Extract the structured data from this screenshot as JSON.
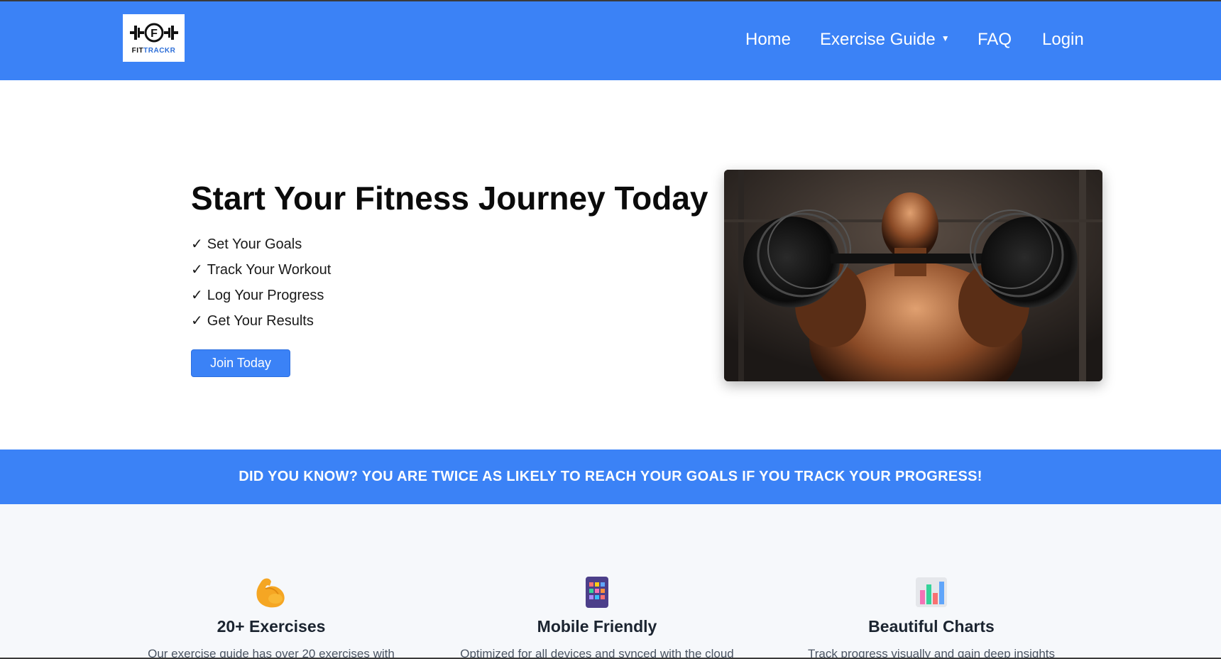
{
  "brand": {
    "logo_text_fit": "FIT",
    "logo_text_trackr": "TRACKR",
    "logo_letter": "F"
  },
  "nav": {
    "home": "Home",
    "exercise_guide": "Exercise Guide",
    "faq": "FAQ",
    "login": "Login"
  },
  "hero": {
    "title": "Start Your Fitness Journey Today",
    "checkmark": "✓",
    "items": [
      "Set Your Goals",
      "Track Your Workout",
      "Log Your Progress",
      "Get Your Results"
    ],
    "cta": "Join Today"
  },
  "banner": {
    "text": "DID YOU KNOW? YOU ARE TWICE AS LIKELY TO REACH YOUR GOALS IF YOU TRACK YOUR PROGRESS!"
  },
  "features": [
    {
      "icon": "flexed-biceps-icon",
      "title": "20+ Exercises",
      "desc": "Our exercise guide has over 20 exercises with"
    },
    {
      "icon": "mobile-app-grid-icon",
      "title": "Mobile Friendly",
      "desc": "Optimized for all devices and synced with the cloud"
    },
    {
      "icon": "bar-chart-icon",
      "title": "Beautiful Charts",
      "desc": "Track progress visually and gain deep insights"
    }
  ],
  "colors": {
    "primary": "#3b82f6",
    "features_bg": "#f6f8fb",
    "text_dark": "#0b0b0b"
  }
}
